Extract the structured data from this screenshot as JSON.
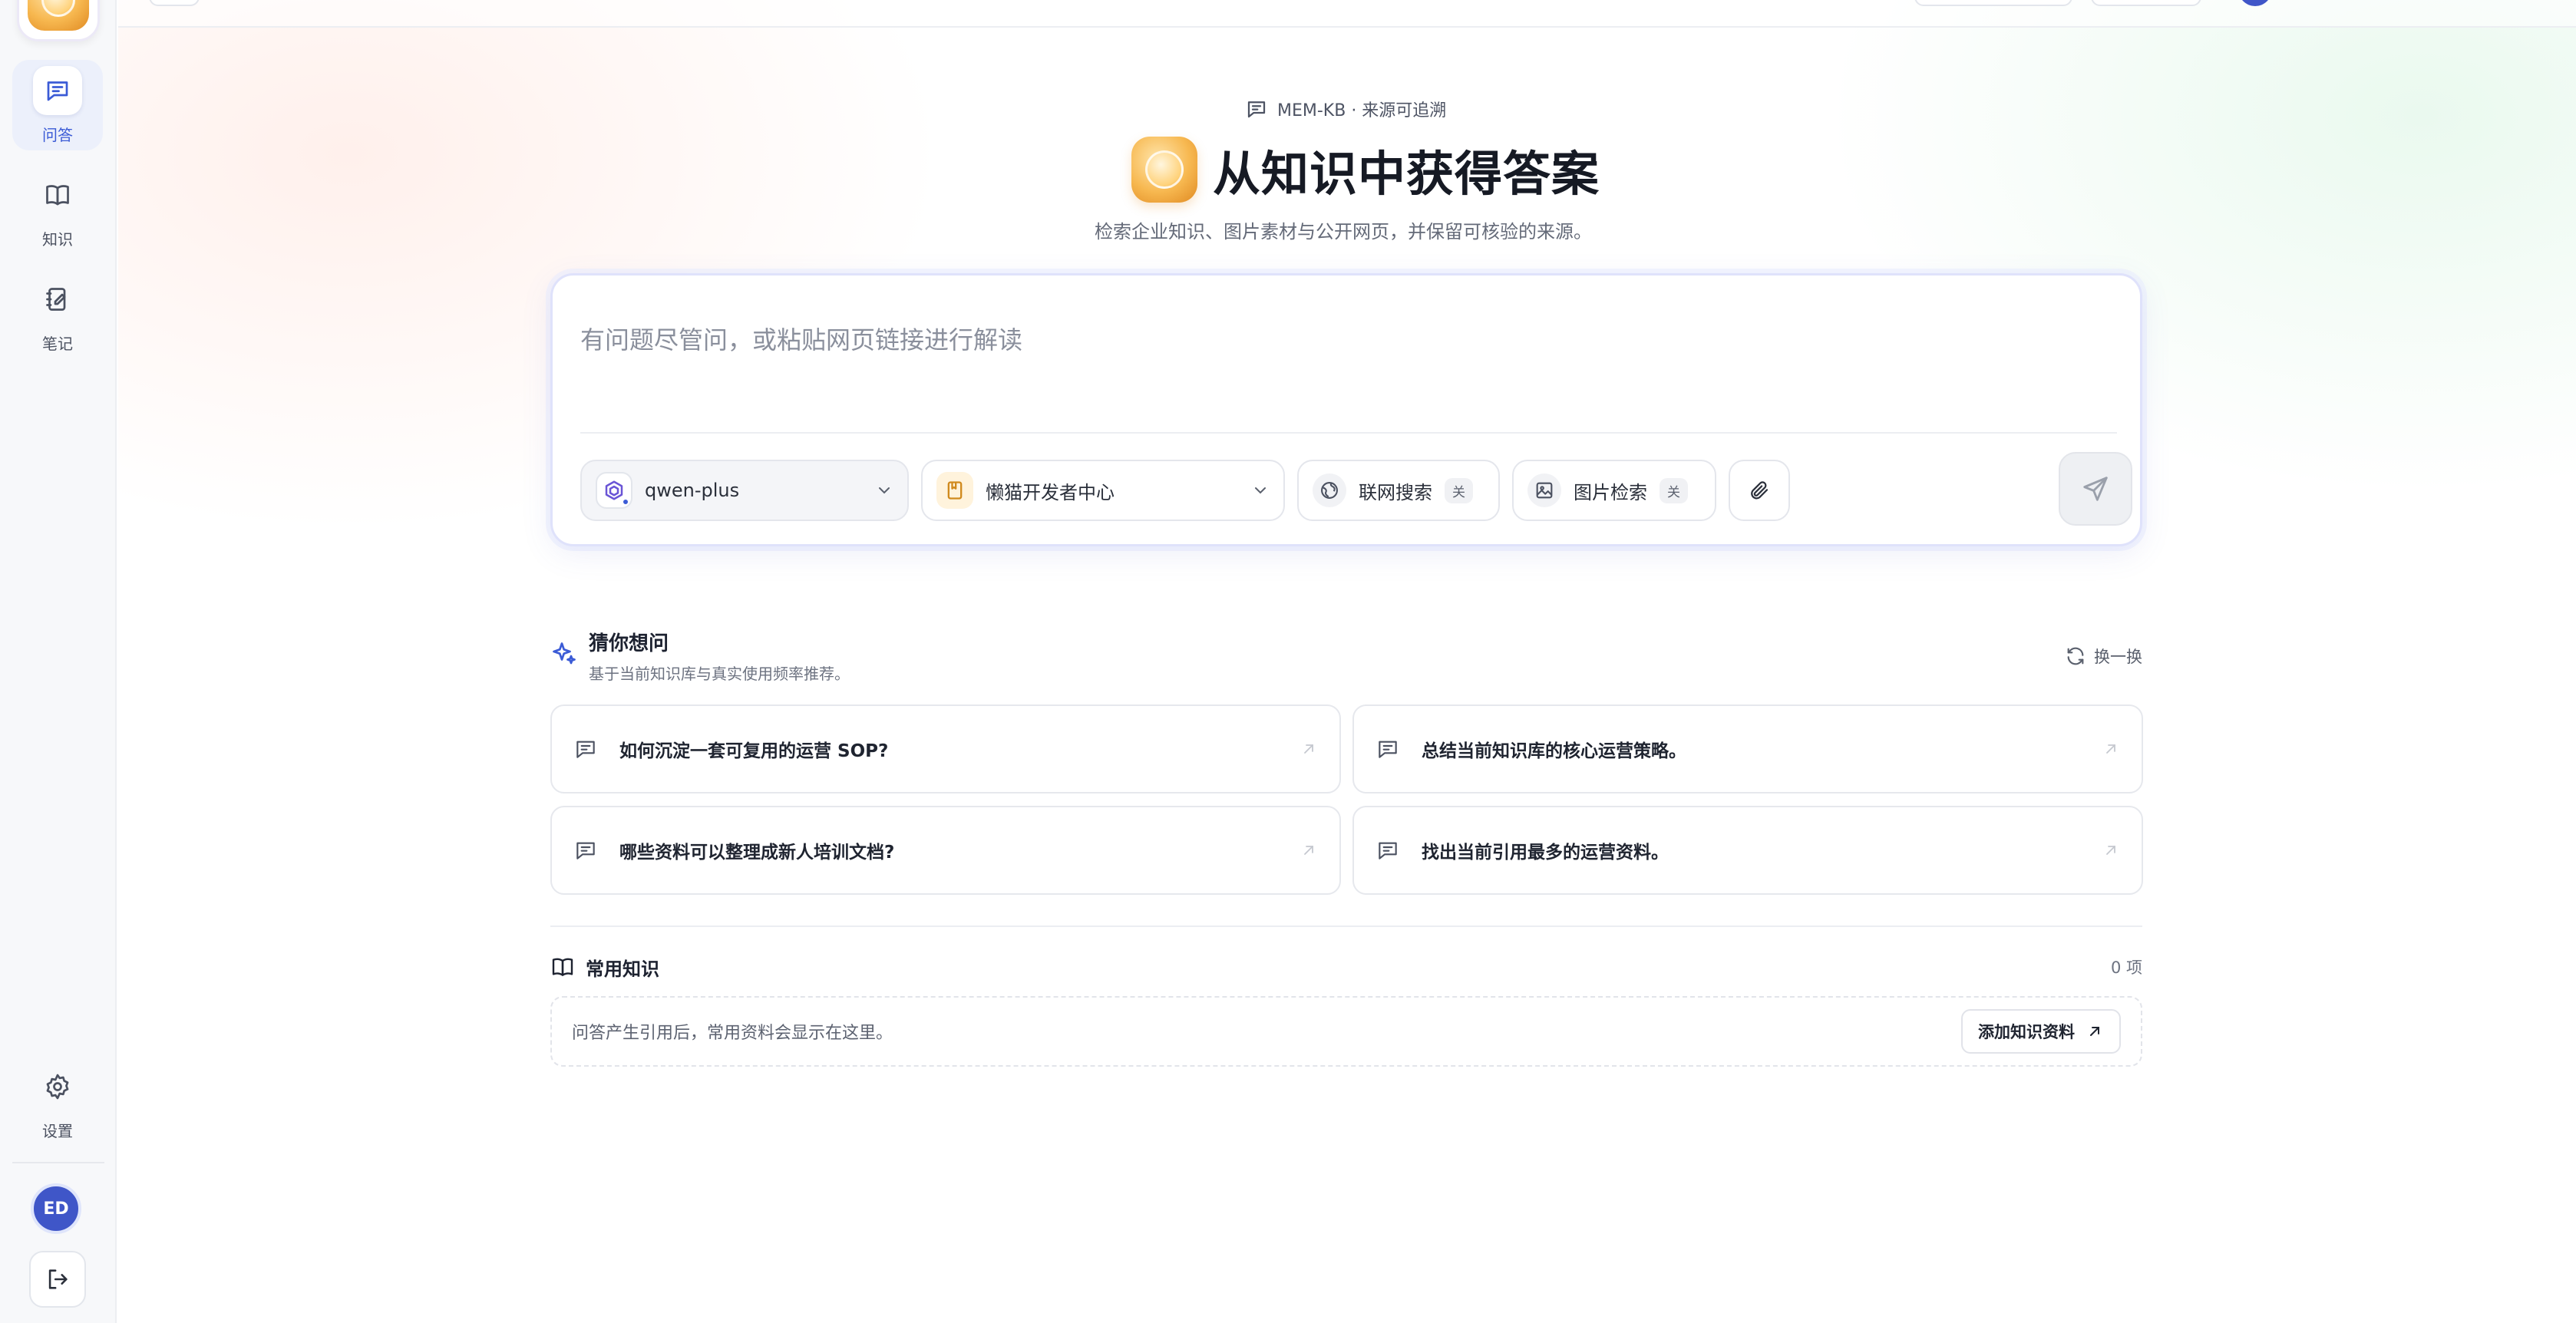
{
  "sidebar": {
    "items": [
      {
        "label": "问答",
        "icon": "chat-icon",
        "active": true
      },
      {
        "label": "知识",
        "icon": "book-icon",
        "active": false
      },
      {
        "label": "笔记",
        "icon": "notebook-icon",
        "active": false
      }
    ],
    "settings_label": "设置",
    "avatar_initials": "ED"
  },
  "hero": {
    "tag": "MEM-KB · 来源可追溯",
    "title": "从知识中获得答案",
    "subtitle": "检索企业知识、图片素材与公开网页，并保留可核验的来源。"
  },
  "search": {
    "placeholder": "有问题尽管问，或粘贴网页链接进行解读",
    "value": "",
    "model": "qwen-plus",
    "knowledge_base": "懒猫开发者中心",
    "web_search_label": "联网搜索",
    "web_search_state": "关",
    "image_search_label": "图片检索",
    "image_search_state": "关"
  },
  "suggestions": {
    "title": "猜你想问",
    "subtitle": "基于当前知识库与真实使用频率推荐。",
    "refresh_label": "换一换",
    "questions": [
      "如何沉淀一套可复用的运营 SOP?",
      "总结当前知识库的核心运营策略。",
      "哪些资料可以整理成新人培训文档?",
      "找出当前引用最多的运营资料。"
    ]
  },
  "common_knowledge": {
    "title": "常用知识",
    "count": "0 项",
    "empty_text": "问答产生引用后，常用资料会显示在这里。",
    "add_label": "添加知识资料"
  },
  "colors": {
    "accent": "#3b5bd6",
    "avatar": "#3f56c8"
  }
}
